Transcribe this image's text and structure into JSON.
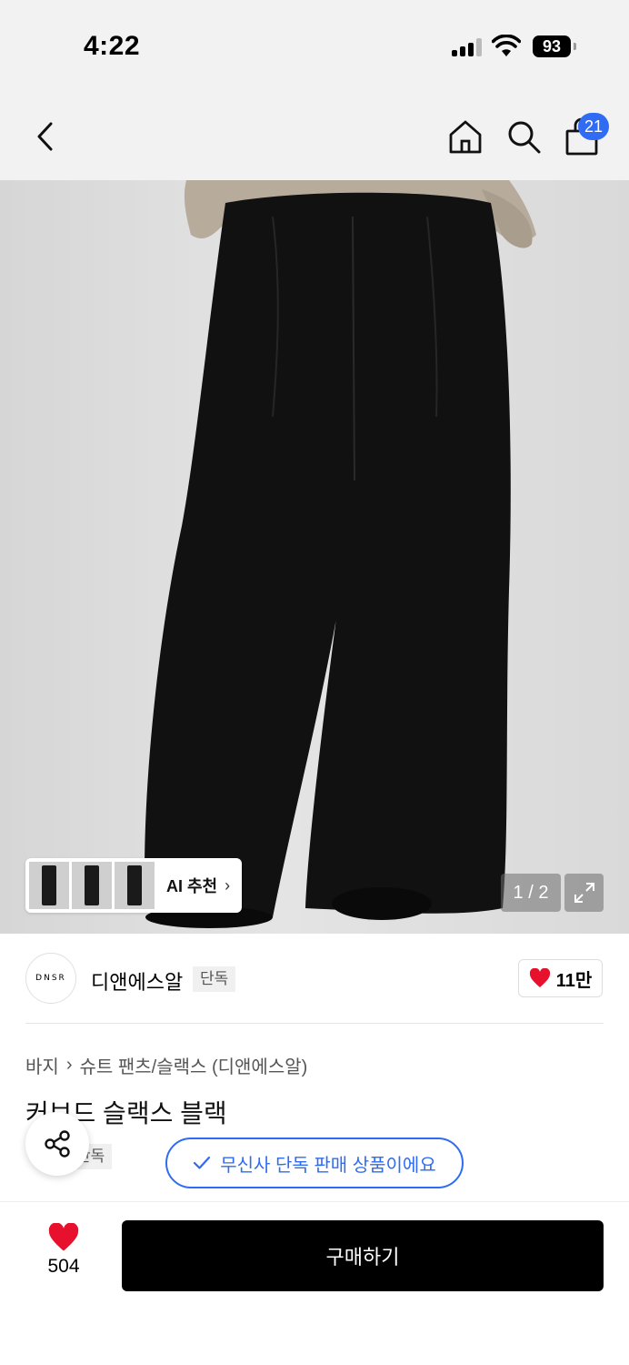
{
  "status_bar": {
    "time": "4:22",
    "battery": "93"
  },
  "nav": {
    "cart_count": "21",
    "icons": [
      "back-arrow-icon",
      "home-icon",
      "search-icon",
      "shopping-bag-icon"
    ]
  },
  "gallery": {
    "ai_label": "AI 추천",
    "page_counter": "1 / 2"
  },
  "brand": {
    "logo_text": "DNSR",
    "name": "디앤에스알",
    "tag": "단독",
    "likes": "11만"
  },
  "breadcrumb": {
    "category": "바지",
    "subcategory": "슈트 팬츠/슬랙스 (디앤에스알)"
  },
  "product": {
    "title": "커브드 슬랙스 블랙",
    "exclusive_tag": "단독",
    "exclusive_notice": "무신사 단독 판매 상품이에요"
  },
  "bottom_bar": {
    "wish_count": "504",
    "buy_label": "구매하기"
  },
  "colors": {
    "accent_blue": "#2f6bf3",
    "heart_red": "#e8112d",
    "buy_black": "#000000"
  }
}
